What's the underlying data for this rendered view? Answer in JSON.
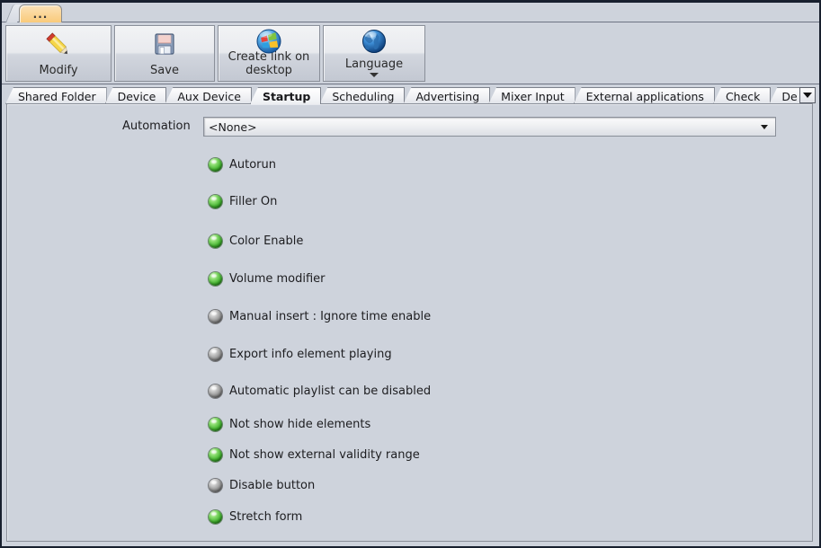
{
  "window": {
    "doc_tab_label": "...",
    "doc_tab_icon": "ellipsis-icon"
  },
  "toolbar": {
    "buttons": [
      {
        "id": "modify",
        "label": "Modify",
        "icon": "pencil-icon",
        "has_dropdown": false
      },
      {
        "id": "save",
        "label": "Save",
        "icon": "floppy-disk-icon",
        "has_dropdown": false
      },
      {
        "id": "link",
        "label": "Create link on desktop",
        "icon": "windows-logo-icon",
        "has_dropdown": false
      },
      {
        "id": "language",
        "label": "Language",
        "icon": "globe-icon",
        "has_dropdown": true
      }
    ]
  },
  "tabs": {
    "items": [
      {
        "label": "Shared Folder",
        "active": false
      },
      {
        "label": "Device",
        "active": false
      },
      {
        "label": "Aux Device",
        "active": false
      },
      {
        "label": "Startup",
        "active": true
      },
      {
        "label": "Scheduling",
        "active": false
      },
      {
        "label": "Advertising",
        "active": false
      },
      {
        "label": "Mixer Input",
        "active": false
      },
      {
        "label": "External applications",
        "active": false
      },
      {
        "label": "Check",
        "active": false
      },
      {
        "label": "De",
        "active": false
      }
    ],
    "overflow_icon": "chevron-down-icon"
  },
  "startup": {
    "automation": {
      "label": "Automation",
      "value": "<None>",
      "placeholder": "<None>",
      "dropdown_icon": "chevron-down-icon"
    },
    "options": [
      {
        "label": "Autorun",
        "state": "on"
      },
      {
        "label": "Filler On",
        "state": "on"
      },
      {
        "label": "Color Enable",
        "state": "on"
      },
      {
        "label": "Volume modifier",
        "state": "on"
      },
      {
        "label": "Manual insert : Ignore time enable",
        "state": "off"
      },
      {
        "label": "Export info element playing",
        "state": "off"
      },
      {
        "label": "Automatic playlist can be disabled",
        "state": "off"
      },
      {
        "label": "Not show hide elements",
        "state": "on"
      },
      {
        "label": "Not show external validity range",
        "state": "on"
      },
      {
        "label": "Disable button",
        "state": "off"
      },
      {
        "label": "Stretch form",
        "state": "on"
      }
    ]
  },
  "colors": {
    "panel_background": "#ced3dc",
    "led_on": "#3fb02c",
    "led_off": "#8e8e8e",
    "doc_tab": "#f9c978",
    "window_border": "#18202e"
  }
}
